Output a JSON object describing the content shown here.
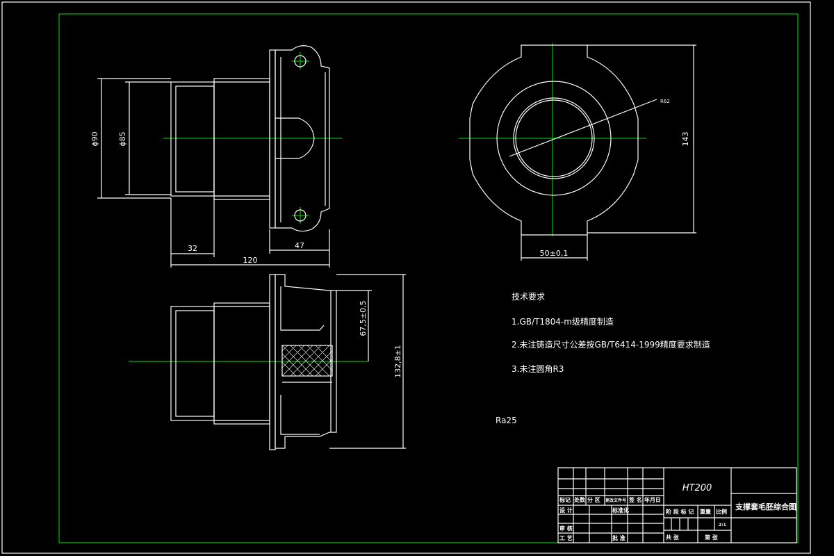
{
  "colors": {
    "background": "#000000",
    "lines": "#ffffff",
    "frame": "#00e000",
    "center_lines": "#00e000",
    "dimensions": "#ffffff"
  },
  "dimensions": {
    "d90": "ϕ90",
    "d85": "ϕ85",
    "len32": "32",
    "len47": "47",
    "len120": "120",
    "width50": "50±0,1",
    "height143": "143",
    "r62": "R62",
    "h67": "67,5±0,5",
    "h132": "132,8±1"
  },
  "tech_requirements": {
    "title": "技术要求",
    "items": [
      "1.GB/T1804-m级精度制造",
      "2.未注铸造尺寸公差按GB/T6414-1999精度要求制造",
      "3.未注圆角R3"
    ]
  },
  "roughness": "Ra25",
  "title_block": {
    "material": "HT200",
    "drawing_name": "支撑套毛胚综合图",
    "header_cells": [
      "标记",
      "处数",
      "分 区",
      "更改文件号",
      "签 名",
      "年月日"
    ],
    "rows": [
      "设 计",
      "标准化",
      "审 核",
      "工 艺",
      "批 准"
    ],
    "stage_labels": [
      "阶 段 标 记",
      "重量",
      "比例"
    ],
    "scale": "2:1",
    "sheets_total": "共 张",
    "sheet_no": "第 张"
  }
}
